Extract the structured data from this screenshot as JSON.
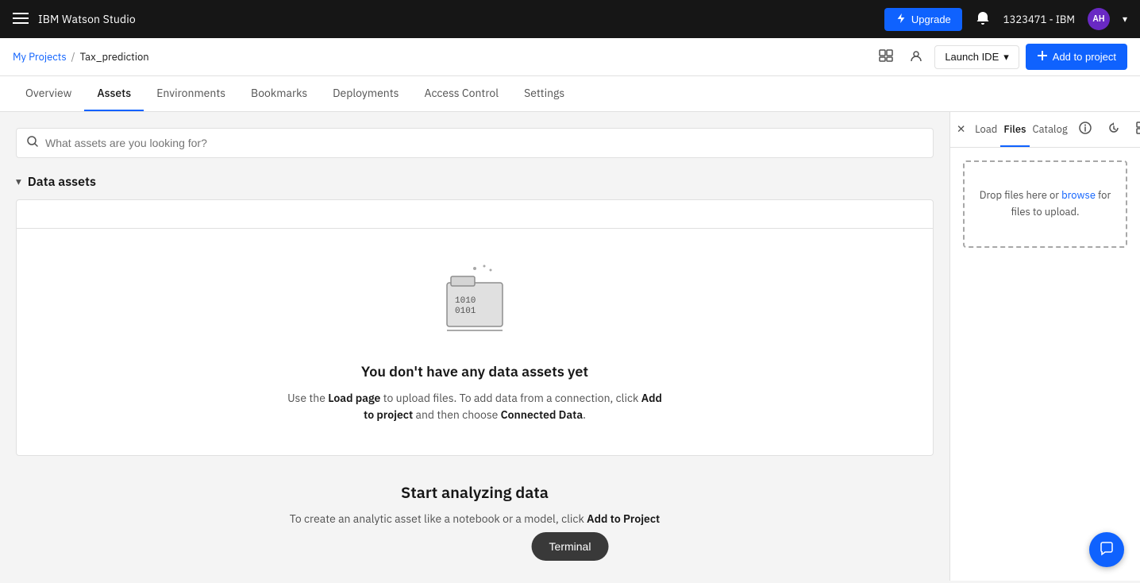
{
  "topbar": {
    "brand": "IBM Watson Studio",
    "upgrade_label": "Upgrade",
    "user_id": "1323471 - IBM",
    "avatar_initials": "AH",
    "hamburger_icon": "hamburger-icon",
    "bell_icon": "bell-icon",
    "chevron_icon": "chevron-down-icon"
  },
  "breadcrumb": {
    "my_projects_label": "My Projects",
    "separator": "/",
    "current_project": "Tax_prediction",
    "launch_ide_label": "Launch IDE",
    "add_to_project_label": "Add to project"
  },
  "tabs": [
    {
      "label": "Overview",
      "id": "overview",
      "active": false
    },
    {
      "label": "Assets",
      "id": "assets",
      "active": true
    },
    {
      "label": "Environments",
      "id": "environments",
      "active": false
    },
    {
      "label": "Bookmarks",
      "id": "bookmarks",
      "active": false
    },
    {
      "label": "Deployments",
      "id": "deployments",
      "active": false
    },
    {
      "label": "Access Control",
      "id": "access-control",
      "active": false
    },
    {
      "label": "Settings",
      "id": "settings",
      "active": false
    }
  ],
  "search": {
    "placeholder": "What assets are you looking for?"
  },
  "data_assets_section": {
    "title": "Data assets"
  },
  "empty_state": {
    "title": "You don't have any data assets yet",
    "description_1": "Use the ",
    "load_page_label": "Load page",
    "description_2": " to upload files. To add data from a connection, click ",
    "add_to_project_label": "Add to project",
    "description_3": " and then choose ",
    "connected_data_label": "Connected Data",
    "description_4": "."
  },
  "start_analyzing": {
    "title": "Start analyzing data",
    "description_1": "To create an analytic asset like a notebook or a model, click ",
    "add_to_project_label": "Add to Project"
  },
  "right_panel": {
    "tabs": [
      {
        "label": "Load",
        "id": "load",
        "active": false
      },
      {
        "label": "Files",
        "id": "files",
        "active": true
      },
      {
        "label": "Catalog",
        "id": "catalog",
        "active": false
      }
    ],
    "drop_zone": {
      "text_1": "Drop files here or ",
      "browse_label": "browse",
      "text_2": " for files to upload."
    }
  },
  "terminal": {
    "label": "Terminal"
  },
  "colors": {
    "accent": "#0f62fe",
    "brand_dark": "#161616",
    "muted": "#525252"
  }
}
